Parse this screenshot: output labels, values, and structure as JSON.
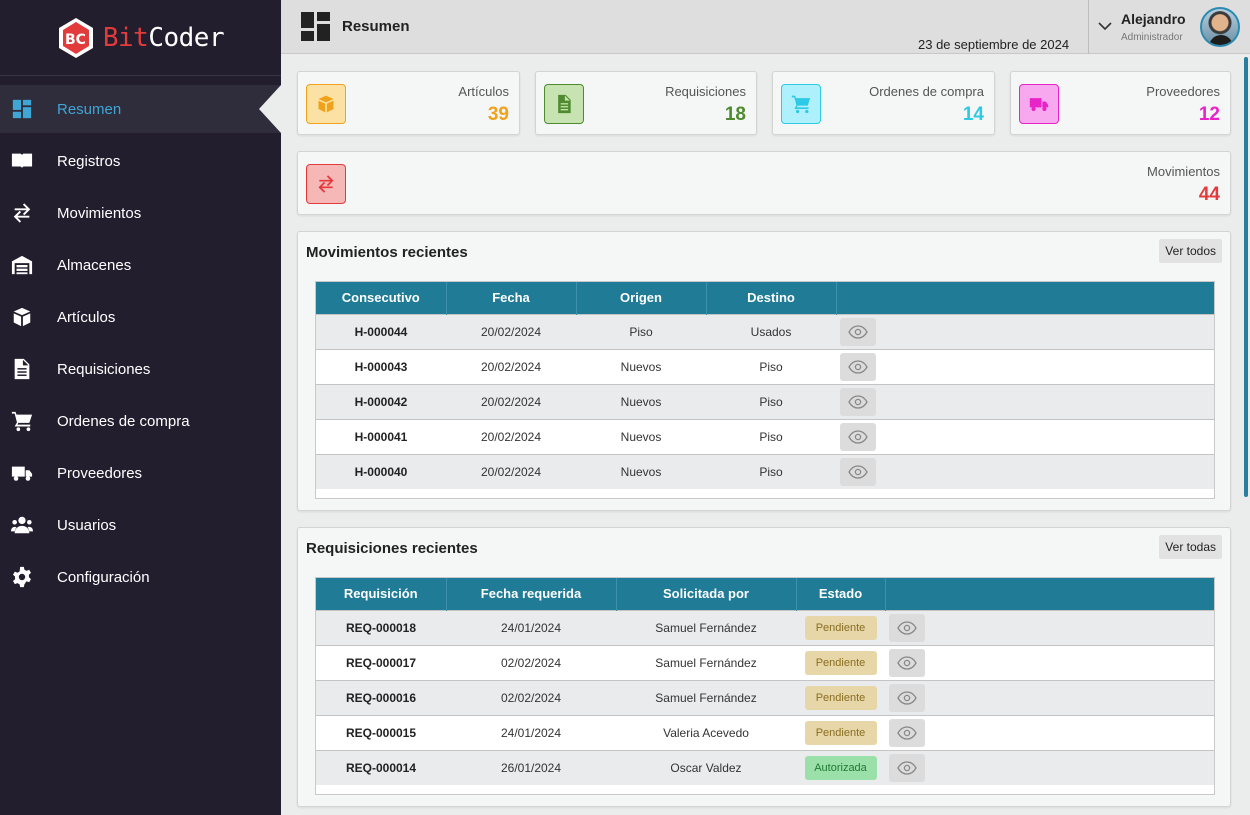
{
  "brand": {
    "part1": "Bit",
    "part2": "Coder"
  },
  "sidebar": {
    "items": [
      {
        "label": "Resumen",
        "icon": "dashboard-icon",
        "active": true
      },
      {
        "label": "Registros",
        "icon": "book-icon"
      },
      {
        "label": "Movimientos",
        "icon": "exchange-icon"
      },
      {
        "label": "Almacenes",
        "icon": "warehouse-icon"
      },
      {
        "label": "Artículos",
        "icon": "box-icon"
      },
      {
        "label": "Requisiciones",
        "icon": "document-icon"
      },
      {
        "label": "Ordenes de compra",
        "icon": "cart-icon"
      },
      {
        "label": "Proveedores",
        "icon": "truck-icon"
      },
      {
        "label": "Usuarios",
        "icon": "users-icon"
      },
      {
        "label": "Configuración",
        "icon": "gear-icon"
      }
    ]
  },
  "header": {
    "title": "Resumen",
    "date": "23 de septiembre de 2024",
    "user_name": "Alejandro",
    "user_role": "Administrador"
  },
  "stats": {
    "articulos": {
      "label": "Artículos",
      "value": "39",
      "color": "#f0a21c",
      "bg": "#fbe2a4",
      "icon": "box-icon"
    },
    "requisiciones": {
      "label": "Requisiciones",
      "value": "18",
      "color": "#4f8a2f",
      "bg": "#c6e3b1",
      "icon": "document-icon"
    },
    "ordenes": {
      "label": "Ordenes de compra",
      "value": "14",
      "color": "#2ec9e6",
      "bg": "#aef0fb",
      "icon": "cart-icon"
    },
    "proveedores": {
      "label": "Proveedores",
      "value": "12",
      "color": "#e624c8",
      "bg": "#f8a8ee",
      "icon": "truck-icon"
    },
    "movimientos": {
      "label": "Movimientos",
      "value": "44",
      "color": "#e33b3b",
      "bg": "#f6b7b7",
      "icon": "exchange-icon"
    }
  },
  "movimientos_recientes": {
    "title": "Movimientos recientes",
    "button": "Ver todos",
    "columns": [
      "Consecutivo",
      "Fecha",
      "Origen",
      "Destino",
      ""
    ],
    "rows": [
      {
        "code": "H-000044",
        "fecha": "20/02/2024",
        "origen": "Piso",
        "destino": "Usados"
      },
      {
        "code": "H-000043",
        "fecha": "20/02/2024",
        "origen": "Nuevos",
        "destino": "Piso"
      },
      {
        "code": "H-000042",
        "fecha": "20/02/2024",
        "origen": "Nuevos",
        "destino": "Piso"
      },
      {
        "code": "H-000041",
        "fecha": "20/02/2024",
        "origen": "Nuevos",
        "destino": "Piso"
      },
      {
        "code": "H-000040",
        "fecha": "20/02/2024",
        "origen": "Nuevos",
        "destino": "Piso"
      }
    ]
  },
  "requisiciones_recientes": {
    "title": "Requisiciones recientes",
    "button": "Ver todas",
    "columns": [
      "Requisición",
      "Fecha requerida",
      "Solicitada por",
      "Estado",
      ""
    ],
    "rows": [
      {
        "code": "REQ-000018",
        "fecha": "24/01/2024",
        "solicitante": "Samuel Fernández",
        "estado": "Pendiente",
        "tipo": "pending"
      },
      {
        "code": "REQ-000017",
        "fecha": "02/02/2024",
        "solicitante": "Samuel Fernández",
        "estado": "Pendiente",
        "tipo": "pending"
      },
      {
        "code": "REQ-000016",
        "fecha": "02/02/2024",
        "solicitante": "Samuel Fernández",
        "estado": "Pendiente",
        "tipo": "pending"
      },
      {
        "code": "REQ-000015",
        "fecha": "24/01/2024",
        "solicitante": "Valeria Acevedo",
        "estado": "Pendiente",
        "tipo": "pending"
      },
      {
        "code": "REQ-000014",
        "fecha": "26/01/2024",
        "solicitante": "Oscar Valdez",
        "estado": "Autorizada",
        "tipo": "auth"
      }
    ]
  },
  "colors": {
    "sidebar_bg": "#221e2e",
    "accent": "#3fa6d6",
    "table_header": "#1f7b96"
  }
}
